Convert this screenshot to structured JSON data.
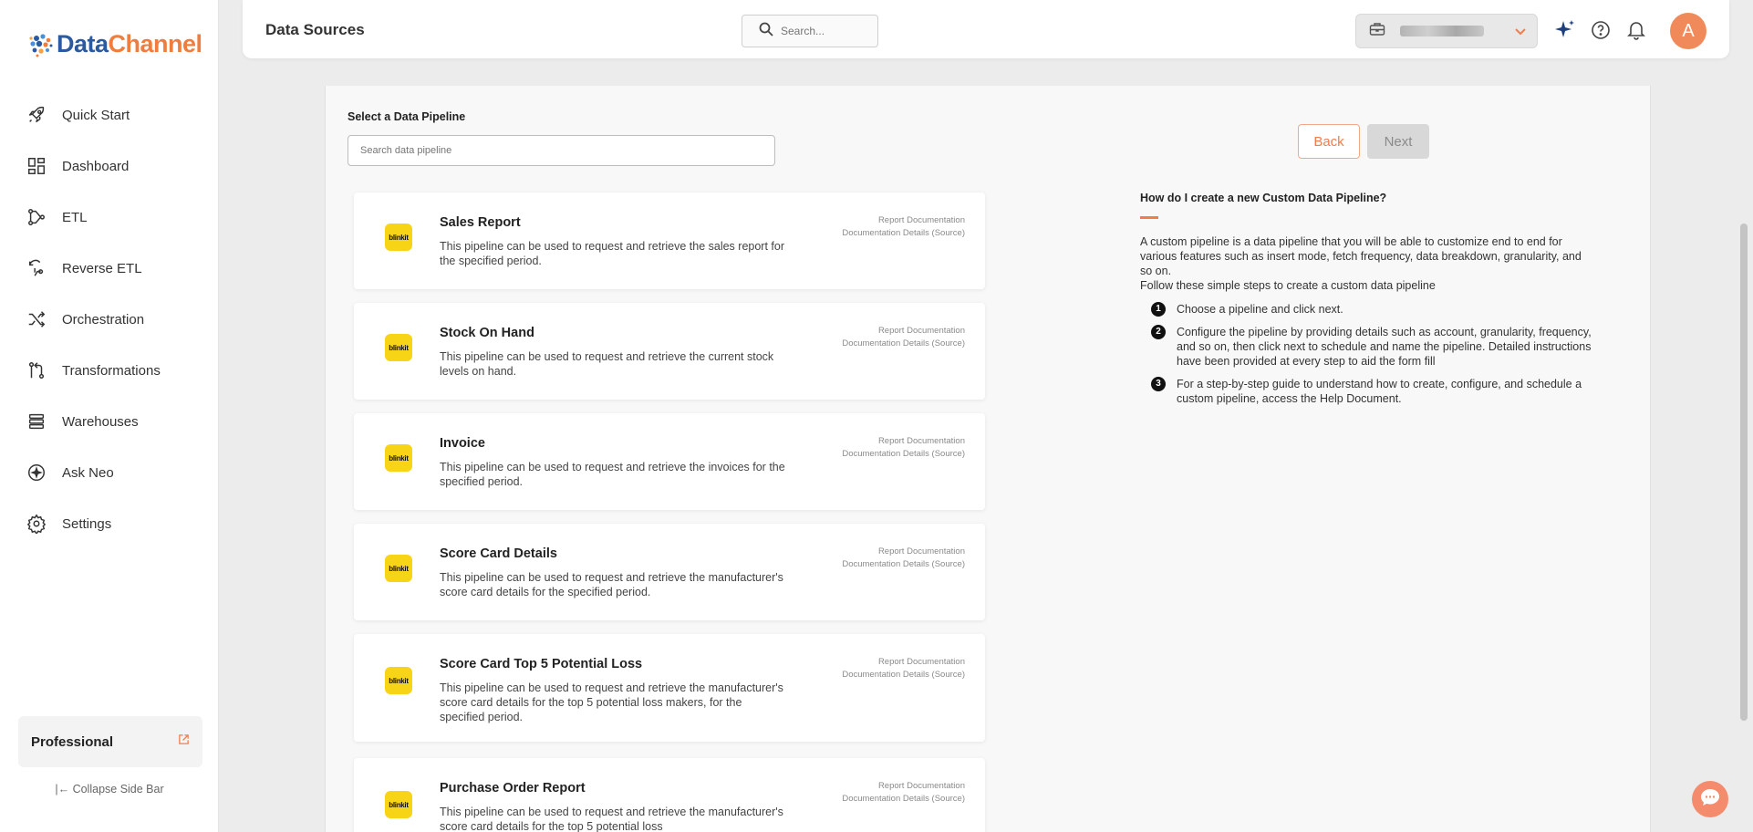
{
  "brand": {
    "part1": "Data",
    "part2": "Channel"
  },
  "nav": [
    {
      "id": "quick-start",
      "label": "Quick Start",
      "icon": "rocket-icon"
    },
    {
      "id": "dashboard",
      "label": "Dashboard",
      "icon": "dashboard-icon"
    },
    {
      "id": "etl",
      "label": "ETL",
      "icon": "etl-icon"
    },
    {
      "id": "reverse-etl",
      "label": "Reverse ETL",
      "icon": "reverse-etl-icon"
    },
    {
      "id": "orchestration",
      "label": "Orchestration",
      "icon": "orchestration-icon"
    },
    {
      "id": "transformations",
      "label": "Transformations",
      "icon": "transformations-icon"
    },
    {
      "id": "warehouses",
      "label": "Warehouses",
      "icon": "warehouses-icon"
    },
    {
      "id": "ask-neo",
      "label": "Ask Neo",
      "icon": "sparkle-icon"
    },
    {
      "id": "settings",
      "label": "Settings",
      "icon": "gear-icon"
    }
  ],
  "plan": {
    "label": "Professional"
  },
  "collapse_label": "Collapse Side Bar",
  "header": {
    "title": "Data Sources",
    "search_placeholder": "Search...",
    "avatar_initial": "A"
  },
  "main": {
    "select_label": "Select a Data Pipeline",
    "search_placeholder": "Search data pipeline",
    "back_label": "Back",
    "next_label": "Next"
  },
  "pipelines": [
    {
      "title": "Sales Report",
      "desc": "This pipeline can be used to request and retrieve the sales report for the specified period.",
      "link1": "Report Documentation",
      "link2": "Documentation Details (Source)",
      "logo": "blinkit"
    },
    {
      "title": "Stock On Hand",
      "desc": "This pipeline can be used to request and retrieve the current stock levels on hand.",
      "link1": "Report Documentation",
      "link2": "Documentation Details (Source)",
      "logo": "blinkit"
    },
    {
      "title": "Invoice",
      "desc": "This pipeline can be used to request and retrieve the invoices for the specified period.",
      "link1": "Report Documentation",
      "link2": "Documentation Details (Source)",
      "logo": "blinkit"
    },
    {
      "title": "Score Card Details",
      "desc": "This pipeline can be used to request and retrieve the manufacturer's score card details for the specified period.",
      "link1": "Report Documentation",
      "link2": "Documentation Details (Source)",
      "logo": "blinkit"
    },
    {
      "title": "Score Card Top 5 Potential Loss",
      "desc": "This pipeline can be used to request and retrieve the manufacturer's score card details for the top 5 potential loss makers, for the specified period.",
      "link1": "Report Documentation",
      "link2": "Documentation Details (Source)",
      "logo": "blinkit"
    },
    {
      "title": "Purchase Order Report",
      "desc": "This pipeline can be used to request and retrieve the manufacturer's score card details for the top 5 potential loss",
      "link1": "Report Documentation",
      "link2": "Documentation Details (Source)",
      "logo": "blinkit"
    }
  ],
  "help": {
    "title": "How do I create a new Custom Data Pipeline?",
    "intro": "A custom pipeline is a data pipeline that you will be able to customize end to end for various features such as insert mode, fetch frequency, data breakdown, granularity, and so on.",
    "follow": "Follow these simple steps to create a custom data pipeline",
    "steps": [
      {
        "num": "1",
        "text": "Choose a pipeline and click next."
      },
      {
        "num": "2",
        "text": "Configure the pipeline by providing details such as account, granularity, frequency, and so on, then click next to schedule and name the pipeline. Detailed instructions have been provided at every step to aid the form fill"
      },
      {
        "num": "3",
        "text": "For a step-by-step guide to understand how to create, configure, and schedule a custom pipeline, access the Help Document."
      }
    ]
  },
  "colors": {
    "accent": "#f07d4c",
    "brand_blue": "#2c5aa0",
    "blinkit_yellow": "#f8d417"
  }
}
